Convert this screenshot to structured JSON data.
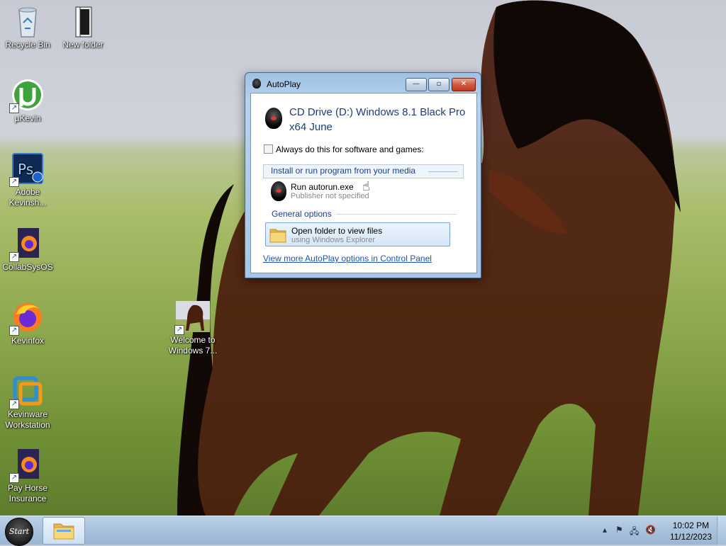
{
  "desktop": {
    "icons": [
      {
        "label": "Recycle Bin",
        "icon": "recycle-bin-icon"
      },
      {
        "label": "New folder",
        "icon": "folder-icon"
      },
      {
        "label": "µKevin",
        "icon": "utorrent-icon"
      },
      {
        "label": "Adobe Kevinsh...",
        "icon": "photoshop-icon"
      },
      {
        "label": "CollabSysOS",
        "icon": "firefox-doc-icon"
      },
      {
        "label": "Kevinfox",
        "icon": "firefox-icon"
      },
      {
        "label": "Kevinware Workstation",
        "icon": "workstation-icon"
      },
      {
        "label": "Pay Horse Insurance",
        "icon": "firefox-doc-icon"
      },
      {
        "label": "Welcome to Windows 7...",
        "icon": "horse-image-icon"
      }
    ]
  },
  "autoplay": {
    "title": "AutoPlay",
    "controls": {
      "minimize": "—",
      "maximize": "▫",
      "close": "✕"
    },
    "device_title": "CD Drive (D:) Windows 8.1 Black Pro x64 June",
    "always_label": "Always do this for software and games:",
    "always_checked": false,
    "section_install": "Install or run program from your media",
    "run_option": {
      "title": "Run autorun.exe",
      "subtitle": "Publisher not specified"
    },
    "section_general": "General options",
    "folder_option": {
      "title": "Open folder to view files",
      "subtitle": "using Windows Explorer"
    },
    "control_panel_link": "View more AutoPlay options in Control Panel"
  },
  "taskbar": {
    "start_label": "Start",
    "tray_icons": [
      "show-hidden-icons",
      "action-center-flag-icon",
      "network-icon",
      "volume-muted-icon"
    ],
    "time": "10:02 PM",
    "date": "11/12/2023"
  },
  "colors": {
    "link": "#1a55b8",
    "section_header": "#1a3f8d",
    "title_blue": "#1e3f7a",
    "taskbar": "#a9c2dc"
  }
}
